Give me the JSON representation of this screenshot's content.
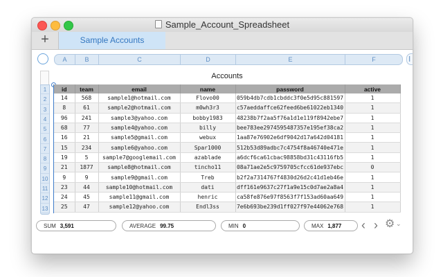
{
  "window": {
    "title": "Sample_Account_Spreadsheet"
  },
  "toolbar": {
    "add_label": "+"
  },
  "tabs": [
    {
      "label": "Sample Accounts"
    }
  ],
  "column_letters": [
    "A",
    "B",
    "C",
    "D",
    "E",
    "F"
  ],
  "row_numbers": [
    "1",
    "2",
    "3",
    "4",
    "5",
    "6",
    "7",
    "8",
    "9",
    "10",
    "11",
    "12",
    "13"
  ],
  "table": {
    "title": "Accounts",
    "headers": [
      "id",
      "team",
      "email",
      "name",
      "password",
      "active"
    ],
    "rows": [
      [
        "14",
        "568",
        "sample1@hotmail.com",
        "Flovo00",
        "059b4db7cdb1cbddc3f0e5d95c881597",
        "1"
      ],
      [
        "8",
        "61",
        "sample2@hotmail.com",
        "m0wh3r3",
        "c57aeddaffce62feed6be61022eb1340",
        "1"
      ],
      [
        "96",
        "241",
        "sample3@yahoo.com",
        "bobby1983",
        "48238b7f2aa5f76a1d1e119f8942ebe7",
        "1"
      ],
      [
        "68",
        "77",
        "sample4@yahoo.com",
        "billy",
        "bee783ee2974595487357e195ef38ca2",
        "1"
      ],
      [
        "16",
        "21",
        "sample5@gmail.com",
        "webux",
        "1aa87e76902e6df9042d17a642d04181",
        "1"
      ],
      [
        "15",
        "234",
        "sample6@yahoo.com",
        "Spar1000",
        "512b53d89adbc7c4754f8a46740e471e",
        "1"
      ],
      [
        "19",
        "5",
        "sample7@googlemail.com",
        "azablade",
        "a6dcf6ca61cbac98858bd31c43116fb5",
        "1"
      ],
      [
        "21",
        "1877",
        "sample8@hotmail.com",
        "tincho11",
        "08a71ae2e5c9759705cfcc61de937ebc",
        "0"
      ],
      [
        "9",
        "9",
        "sample9@gmail.com",
        "Treb",
        "b2f2a7314767f4830d26d2c41d1eb46e",
        "1"
      ],
      [
        "23",
        "44",
        "sample10@hotmail.com",
        "dati",
        "dff161e9637c27f1a9e15c0d7ae2a8a4",
        "1"
      ],
      [
        "24",
        "45",
        "sample11@gmail.com",
        "henric",
        "ca58fe876e97f8563f7f153ad60aa649",
        "1"
      ],
      [
        "25",
        "47",
        "sample12@yahoo.com",
        "Endl3ss",
        "7e6b693be239d1ff027f97e44062e768",
        "1"
      ]
    ]
  },
  "status": {
    "sum_label": "SUM",
    "sum_value": "3,591",
    "avg_label": "AVERAGE",
    "avg_value": "99.75",
    "min_label": "MIN",
    "min_value": "0",
    "max_label": "MAX",
    "max_value": "1,877"
  },
  "icons": {
    "prev": "‹",
    "next": "›",
    "gear": "⚙",
    "caret": "⌄",
    "pause": "❙❙"
  }
}
